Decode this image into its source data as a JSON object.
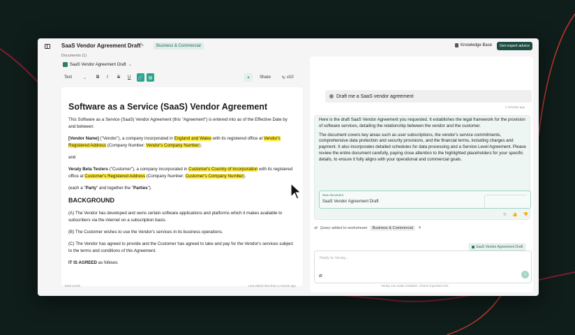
{
  "app": {
    "doc_title": "SaaS Vendor Agreement Draft",
    "category_tag": "Business & Commercial",
    "knowledge_base": "Knowledge Base",
    "expert_advice": "Get expert advice"
  },
  "documents": {
    "label": "Documents (1)",
    "selected": "SaaS Vendor Agreement Draft"
  },
  "toolbar": {
    "style": "Text",
    "bold": "B",
    "italic": "I",
    "strike": "S",
    "underline": "U",
    "share": "Share",
    "version": "v10"
  },
  "editor": {
    "title": "Software as a Service (SaaS) Vendor Agreement",
    "intro": "This Software as a Service (SaaS) Vendor Agreement (this \"Agreement\") is entered into as of the Effective Date by and between:",
    "vendor_name": "[Vendor Name]",
    "vendor_mid1": " (\"Vendor\"), a company incorporated in ",
    "vendor_country": "England and Wales",
    "vendor_mid2": " with its registered office at ",
    "vendor_address": "Vendor's Registered Address",
    "vendor_mid3": " (Company Number: ",
    "vendor_number": "Vendor's Company Number",
    "vendor_end": ");",
    "and": "and",
    "customer_name": "Veraty Beta Testers",
    "customer_mid1": " (\"Customer\"), a company incorporated in ",
    "customer_country": "Customer's Country of Incorporation",
    "customer_mid2": " with its registered office at ",
    "customer_address": "Customer's Registered Address",
    "customer_mid3": " (Company Number: ",
    "customer_number": "Customer's Company Number",
    "customer_end": ").",
    "parties_a": "(each a \"",
    "parties_b": "Party",
    "parties_c": "\" and together the \"",
    "parties_d": "Parties",
    "parties_e": "\").",
    "background": "BACKGROUND",
    "rec_a": "(A) The Vendor has developed and owns certain software applications and platforms which it makes available to subscribers via the internet on a subscription basis.",
    "rec_b": "(B) The Customer wishes to use the Vendor's services in its business operations.",
    "rec_c": "(C) The Vendor has agreed to provide and the Customer has agreed to take and pay for the Vendor's services subject to the terms and conditions of this Agreement.",
    "agreed_bold": "IT IS AGREED",
    "agreed_rest": " as follows:",
    "word_count": "1028 words",
    "last_edited": "Last edited less than a minute ago"
  },
  "chat": {
    "user_message": "Draft me a SaaS vendor agreement",
    "time": "2 minutes ago",
    "ai_p1": "Here is the draft SaaS Vendor Agreement you requested. It establishes the legal framework for the provision of software services, detailing the relationship between the vendor and the customer.",
    "ai_p2": "The document covers key areas such as user subscriptions, the vendor's service commitments, comprehensive data protection and security provisions, and the financial terms, including charges and payment. It also incorporates detailed schedules for data processing and a Service Level Agreement. Please review the entire document carefully, paying close attention to the highlighted placeholders for your specific details, to ensure it fully aligns with your operational and commercial goals.",
    "card_label": "New document",
    "card_title": "SaaS Vendor Agreement Draft",
    "workspace_note": "Query added to workstream",
    "workspace_tag": "Business & Commercial",
    "context_tag": "SaaS Vendor Agreement Draft",
    "placeholder": "Reply to Veraty...",
    "disclaimer": "Veraty can make mistakes. Check important info."
  },
  "icons": [
    "sidebar-toggle-icon",
    "pencil-icon",
    "book-icon",
    "document-icon",
    "chevron-down-icon",
    "link-icon",
    "comment-icon",
    "sparkle-icon",
    "history-icon",
    "user-icon",
    "refresh-icon",
    "thumbs-up-icon",
    "thumbs-down-icon",
    "paperclip-icon",
    "send-icon",
    "cursor-icon"
  ],
  "colors": {
    "accent": "#2aa48a",
    "highlight": "#ffeb3b",
    "dark_button": "#1e4d44"
  }
}
